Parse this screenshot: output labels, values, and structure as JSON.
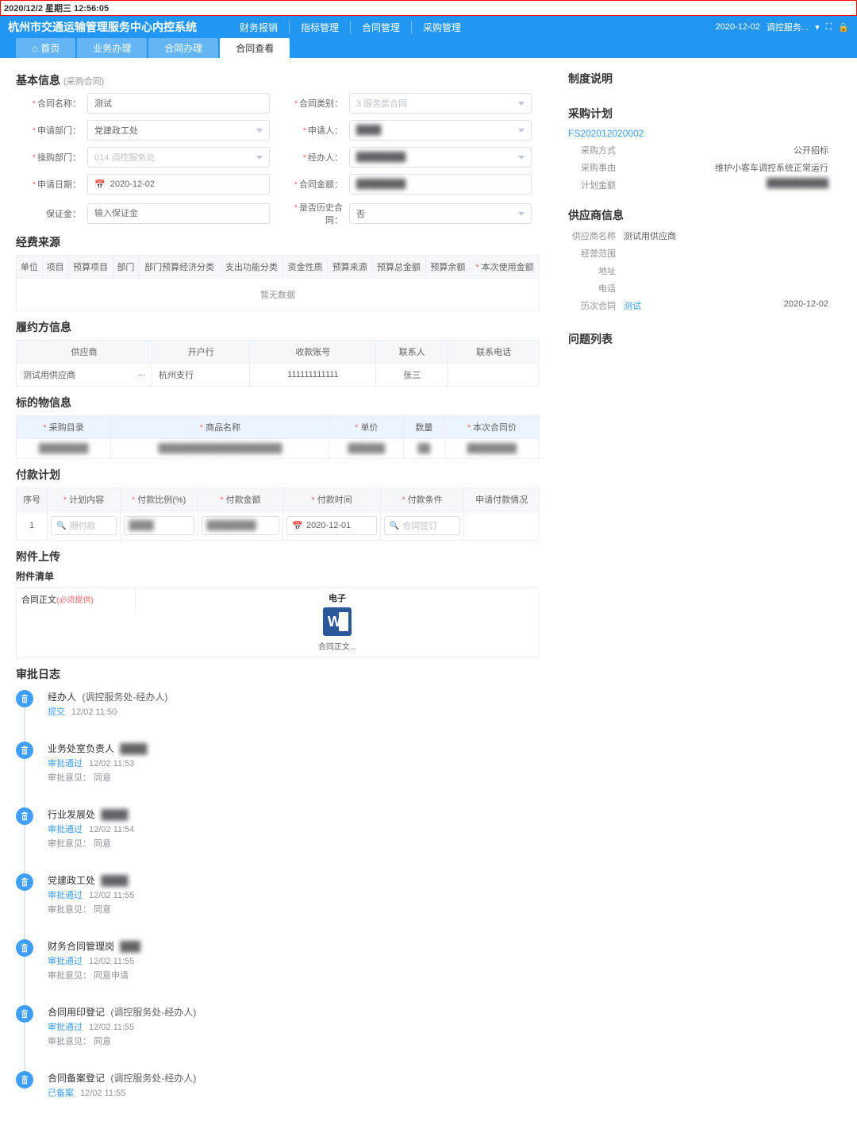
{
  "timestamp": "2020/12/2 星期三 12:56:05",
  "header": {
    "title": "杭州市交通运输管理服务中心内控系统",
    "menu": [
      "财务报销",
      "指标管理",
      "合同管理",
      "采购管理"
    ],
    "date": "2020-12-02",
    "user": "调控服务..."
  },
  "tabs": [
    {
      "label": "首页",
      "home": true
    },
    {
      "label": "业务办理"
    },
    {
      "label": "合同办理"
    },
    {
      "label": "合同查看",
      "active": true
    }
  ],
  "basic": {
    "title": "基本信息",
    "subtitle": "(采购合同)",
    "fields": {
      "contract_name_label": "合同名称：",
      "contract_name": "测试",
      "contract_type_label": "合同类别：",
      "contract_type_ph": "3 服务类合同",
      "apply_dept_label": "申请部门：",
      "apply_dept": "党建政工处",
      "applicant_label": "申请人：",
      "applicant": "████",
      "attr_dept_label": "操购部门：",
      "attr_dept": "014 调控服务处",
      "handler_label": "经办人：",
      "handler": "████████",
      "apply_date_label": "申请日期：",
      "apply_date": "2020-12-02",
      "amount_label": "合同金额：",
      "amount": "████████",
      "deposit_label": "保证金：",
      "deposit_ph": "输入保证金",
      "history_label": "是否历史合同：",
      "history": "否"
    }
  },
  "funds": {
    "title": "经费来源",
    "headers": [
      "单位",
      "项目",
      "预算项目",
      "部门",
      "部门预算经济分类",
      "支出功能分类",
      "资金性质",
      "预算来源",
      "预算总金额",
      "预算余额",
      "本次使用金额"
    ],
    "nodata": "暂无数据"
  },
  "perf": {
    "title": "履约方信息",
    "headers": [
      "供应商",
      "开户行",
      "收款账号",
      "联系人",
      "联系电话"
    ],
    "row": {
      "supplier": "测试用供应商",
      "ellipsis": "...",
      "bank": "杭州支行",
      "account": "111111111111",
      "contact": "张三",
      "phone": ""
    }
  },
  "object": {
    "title": "标的物信息",
    "headers": [
      "采购目录",
      "商品名称",
      "单价",
      "数量",
      "本次合同价"
    ],
    "row": {
      "catalog": "████████",
      "name": "████████████████████",
      "price": "██████",
      "qty": "██",
      "total": "████████"
    }
  },
  "payplan": {
    "title": "付款计划",
    "headers": [
      "序号",
      "计划内容",
      "付款比例(%)",
      "付款金额",
      "付款时间",
      "付款条件",
      "申请付款情况"
    ],
    "row": {
      "seq": "1",
      "content_ph": "期付款",
      "ratio": "████",
      "amount": "████████",
      "date": "2020-12-01",
      "cond_ph": "合同签订",
      "status": ""
    }
  },
  "attach": {
    "title": "附件上传",
    "list_title": "附件清单",
    "label": "合同正文",
    "label_req": "(必须提供)",
    "etitle": "电子",
    "filename": "合同正文..."
  },
  "audit": {
    "title": "审批日志",
    "items": [
      {
        "role": "经办人",
        "who": "(调控服务处-经办人)",
        "status": "提交",
        "time": "12/02 11:50"
      },
      {
        "role": "业务处室负责人",
        "who": "████",
        "status": "审批通过",
        "time": "12/02 11:53",
        "opinion": "审批意见： 同意"
      },
      {
        "role": "行业发展处",
        "who": "████",
        "status": "审批通过",
        "time": "12/02 11:54",
        "opinion": "审批意见： 同意"
      },
      {
        "role": "党建政工处",
        "who": "████",
        "status": "审批通过",
        "time": "12/02 11:55",
        "opinion": "审批意见： 同意"
      },
      {
        "role": "财务合同管理岗",
        "who": "███",
        "status": "审批通过",
        "time": "12/02 11:55",
        "opinion": "审批意见： 同意申请"
      },
      {
        "role": "合同用印登记",
        "who": "(调控服务处-经办人)",
        "status": "审批通过",
        "time": "12/02 11:55",
        "opinion": "审批意见： 同意"
      },
      {
        "role": "合同备案登记",
        "who": "(调控服务处-经办人)",
        "status": "已备案",
        "time": "12/02 11:55"
      }
    ]
  },
  "side": {
    "policy_title": "制度说明",
    "plan_title": "采购计划",
    "plan_no": "FS202012020002",
    "kv": [
      {
        "k": "采购方式",
        "v": "公开招标",
        "right": true
      },
      {
        "k": "采购事由",
        "v": "维护小客车调控系统正常运行",
        "right": true
      },
      {
        "k": "计划金额",
        "v": "██████████",
        "right": true,
        "blur": true
      }
    ],
    "supplier_title": "供应商信息",
    "sup": [
      {
        "k": "供应商名称",
        "v": "测试用供应商"
      },
      {
        "k": "经营范围",
        "v": ""
      },
      {
        "k": "地址",
        "v": ""
      },
      {
        "k": "电话",
        "v": ""
      }
    ],
    "history_k": "历次合同",
    "history_name": "测试",
    "history_date": "2020-12-02",
    "issues_title": "问题列表"
  }
}
